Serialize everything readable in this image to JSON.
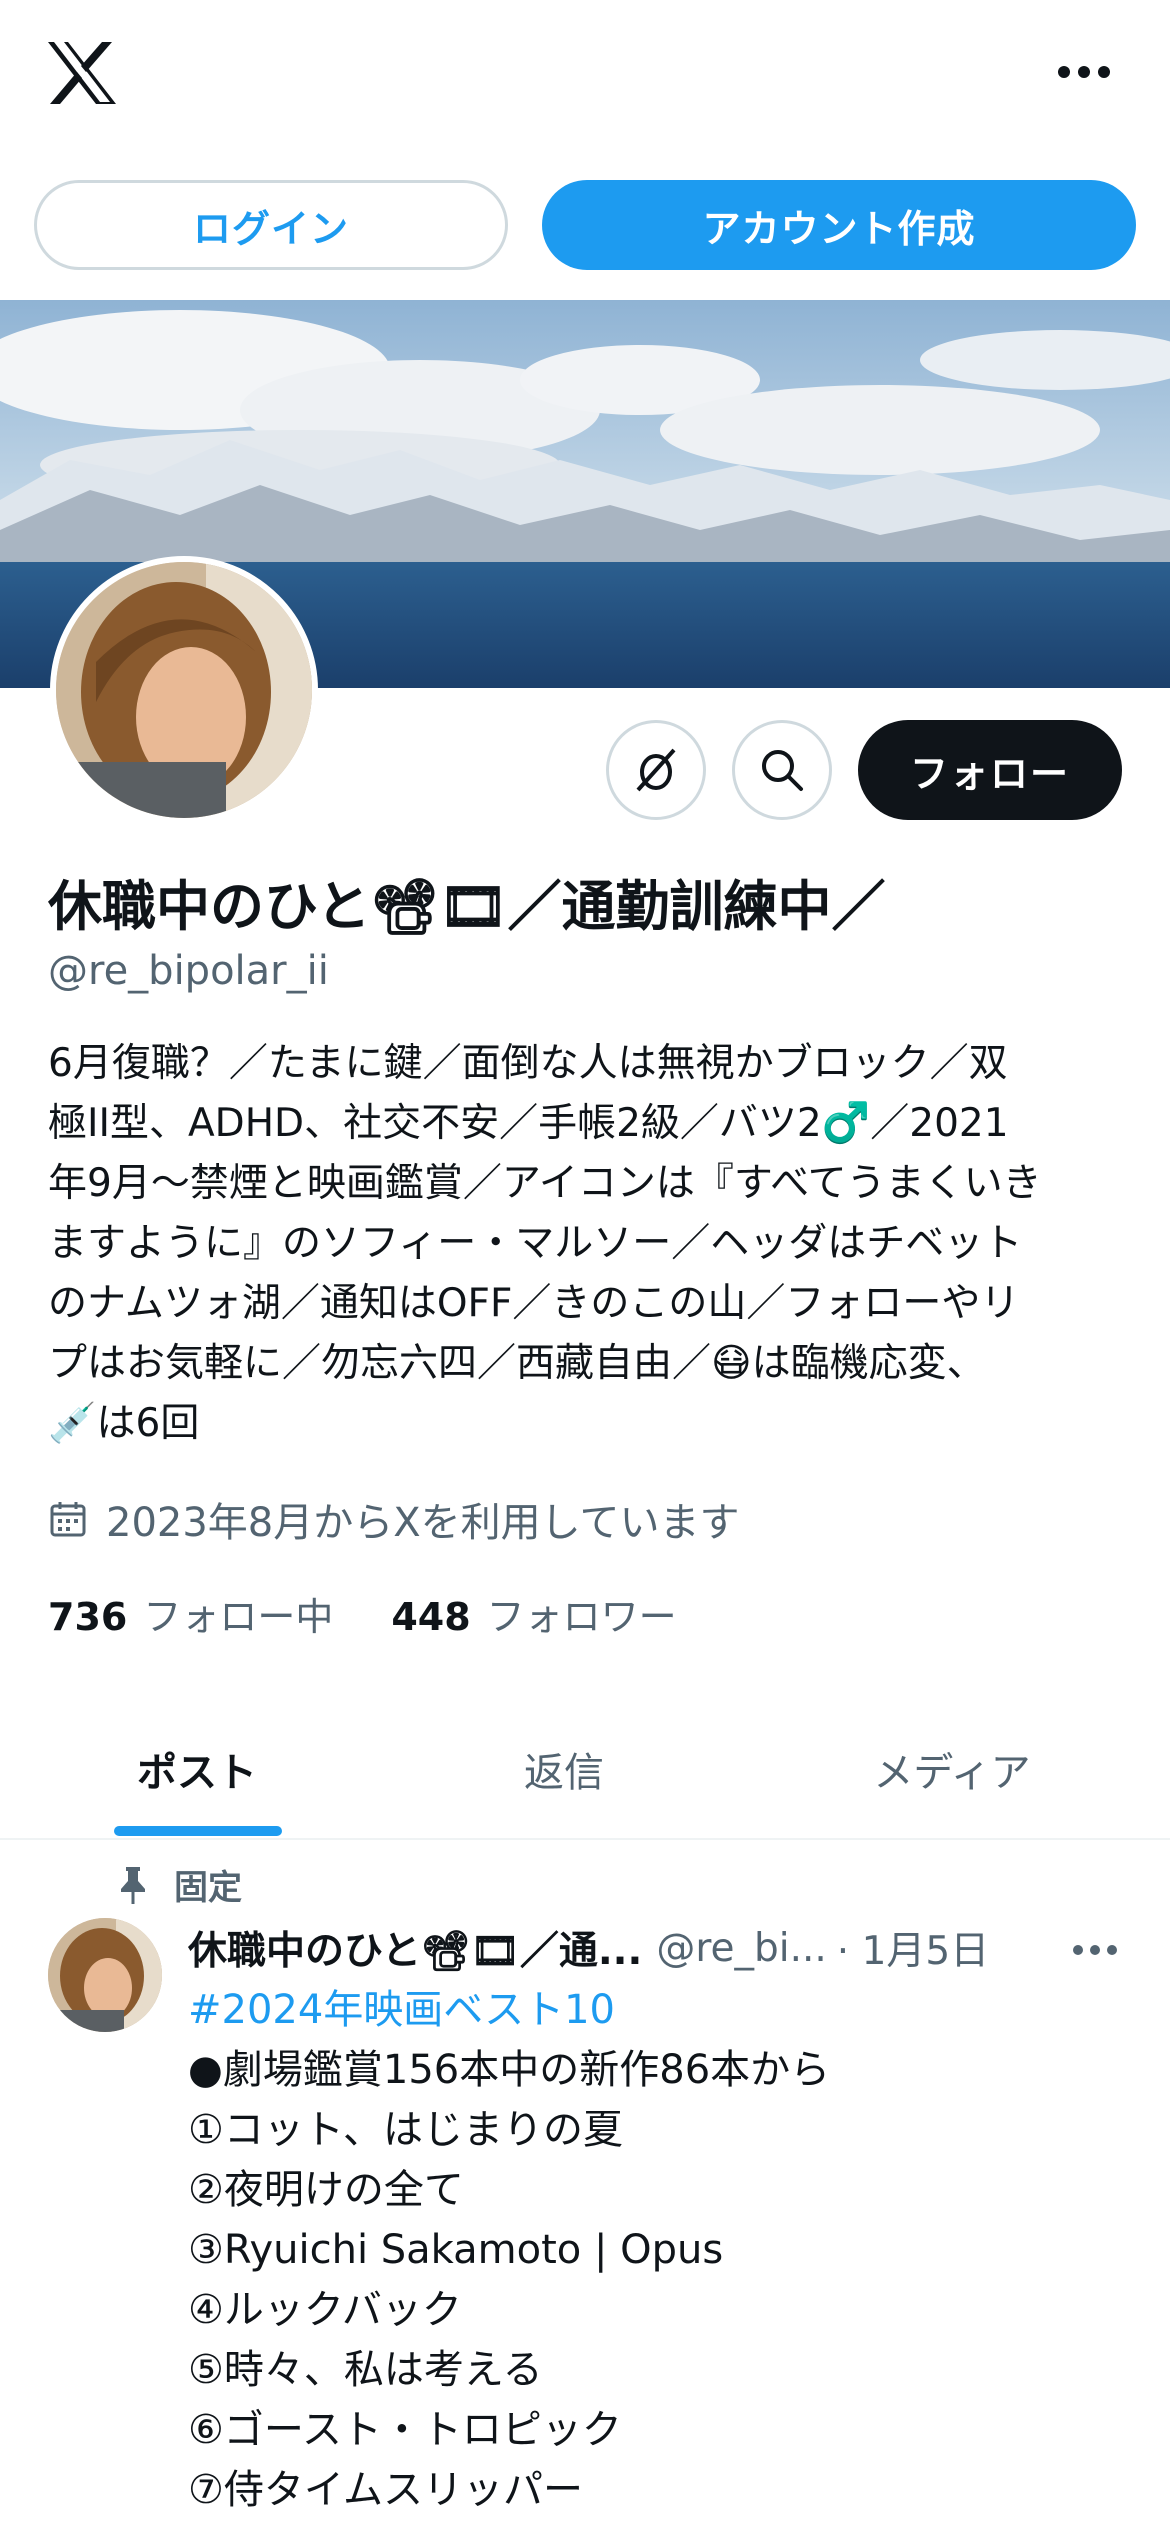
{
  "header": {
    "logo_icon": "x-logo-icon",
    "more_icon": "more-horizontal-icon",
    "login_label": "ログイン",
    "signup_label": "アカウント作成"
  },
  "profile": {
    "display_name": "休職中のひと📽🎞／通勤訓練中／",
    "handle": "@re_bipolar_ii",
    "follow_label": "フォロー",
    "bio_lines": [
      "6月復職？／たまに鍵／面倒な人は無視かブロック／双",
      "極II型、ADHD、社交不安／手帳2級／バツ2♂️／2021",
      "年9月〜禁煙と映画鑑賞／アイコンは『すべてうまくいき",
      "ますように』のソフィー・マルソー／ヘッダはチベット",
      "のナムツォ湖／通知はOFF／きのこの山／フォローやリ",
      "プはお気軽に／勿忘六四／西藏自由／😷は臨機応変、",
      "💉は6回"
    ],
    "joined": "2023年8月からXを利用しています",
    "following_count": "736",
    "following_label": "フォロー中",
    "followers_count": "448",
    "followers_label": "フォロワー"
  },
  "tabs": [
    {
      "label": "ポスト",
      "active": true
    },
    {
      "label": "返信",
      "active": false
    },
    {
      "label": "メディア",
      "active": false
    }
  ],
  "pinned_post": {
    "pinned_label": "固定",
    "author_name": "休職中のひと📽🎞／通...",
    "author_handle": "@re_bi...",
    "date": "· 1月5日",
    "hashtag": "#2024年映画ベスト10",
    "lines": [
      "●劇場鑑賞156本中の新作86本から",
      "①コット、はじまりの夏",
      "②夜明けの全て",
      "③Ryuichi Sakamoto | Opus",
      "④ルックバック",
      "⑤時々、私は考える",
      "⑥ゴースト・トロピック",
      "⑦侍タイムスリッパー"
    ]
  },
  "colors": {
    "accent": "#1d9bf0",
    "text": "#0f1419",
    "secondary": "#536471",
    "border": "#cfd9de"
  }
}
